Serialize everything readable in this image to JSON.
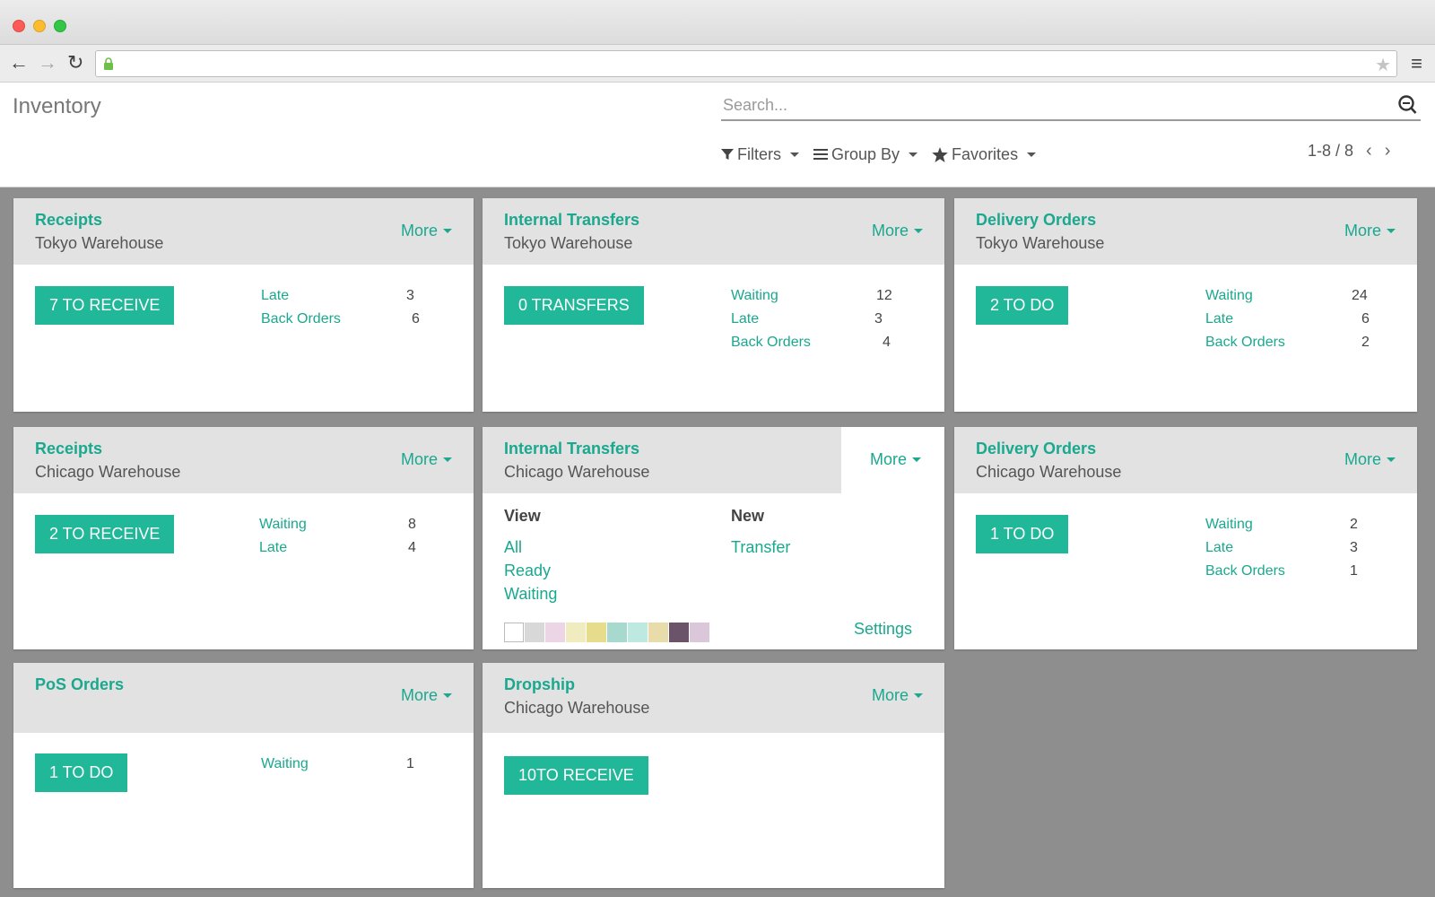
{
  "browser": {
    "back_icon": "←",
    "forward_icon": "→",
    "reload_icon": "↻",
    "star_icon": "★",
    "menu_icon": "≡"
  },
  "header": {
    "title": "Inventory",
    "search_placeholder": "Search...",
    "filters_label": "Filters",
    "groupby_label": "Group By",
    "favorites_label": "Favorites",
    "pager": "1-8 / 8",
    "pager_prev": "‹",
    "pager_next": "›"
  },
  "cards": [
    {
      "title": "Receipts",
      "subtitle": "Tokyo Warehouse",
      "more": "More",
      "button": "7 TO RECEIVE",
      "stats": [
        {
          "label": "Late",
          "value": "3"
        },
        {
          "label": "Back Orders",
          "value": "6"
        }
      ]
    },
    {
      "title": "Internal Transfers",
      "subtitle": "Tokyo Warehouse",
      "more": "More",
      "button": "0 TRANSFERS",
      "stats": [
        {
          "label": "Waiting",
          "value": "12"
        },
        {
          "label": "Late",
          "value": "3"
        },
        {
          "label": "Back Orders",
          "value": "4"
        }
      ]
    },
    {
      "title": "Delivery Orders",
      "subtitle": "Tokyo Warehouse",
      "more": "More",
      "button": "2 TO DO",
      "stats": [
        {
          "label": "Waiting",
          "value": "24"
        },
        {
          "label": "Late",
          "value": "6"
        },
        {
          "label": "Back Orders",
          "value": "2"
        }
      ]
    },
    {
      "title": "Receipts",
      "subtitle": "Chicago Warehouse",
      "more": "More",
      "button": "2 TO RECEIVE",
      "stats": [
        {
          "label": "Waiting",
          "value": "8"
        },
        {
          "label": "Late",
          "value": "4"
        }
      ]
    },
    {
      "title": "Internal Transfers",
      "subtitle": "Chicago Warehouse",
      "more": "More",
      "menu": {
        "view_title": "View",
        "new_title": "New",
        "view_links": [
          "All",
          "Ready",
          "Waiting"
        ],
        "new_links": [
          "Transfer"
        ],
        "settings": "Settings",
        "swatches": [
          "#ffffff",
          "#d8d8d8",
          "#ecd6e6",
          "#f0ecc0",
          "#e6dc8c",
          "#a8d9cf",
          "#bde9e1",
          "#e8dcaa",
          "#6b5469",
          "#dac7da"
        ]
      }
    },
    {
      "title": "Delivery Orders",
      "subtitle": "Chicago Warehouse",
      "more": "More",
      "button": "1 TO DO",
      "stats": [
        {
          "label": "Waiting",
          "value": "2"
        },
        {
          "label": "Late",
          "value": "3"
        },
        {
          "label": "Back Orders",
          "value": "1"
        }
      ]
    },
    {
      "title": "PoS Orders",
      "subtitle": "",
      "more": "More",
      "button": "1 TO DO",
      "stats": [
        {
          "label": "Waiting",
          "value": "1"
        }
      ]
    },
    {
      "title": "Dropship",
      "subtitle": "Chicago Warehouse",
      "more": "More",
      "button": "10TO RECEIVE",
      "stats": []
    }
  ],
  "colors": {
    "accent": "#1aa88e",
    "button": "#21b799",
    "board_bg": "#8e8e8e",
    "card_head": "#e2e2e2"
  }
}
